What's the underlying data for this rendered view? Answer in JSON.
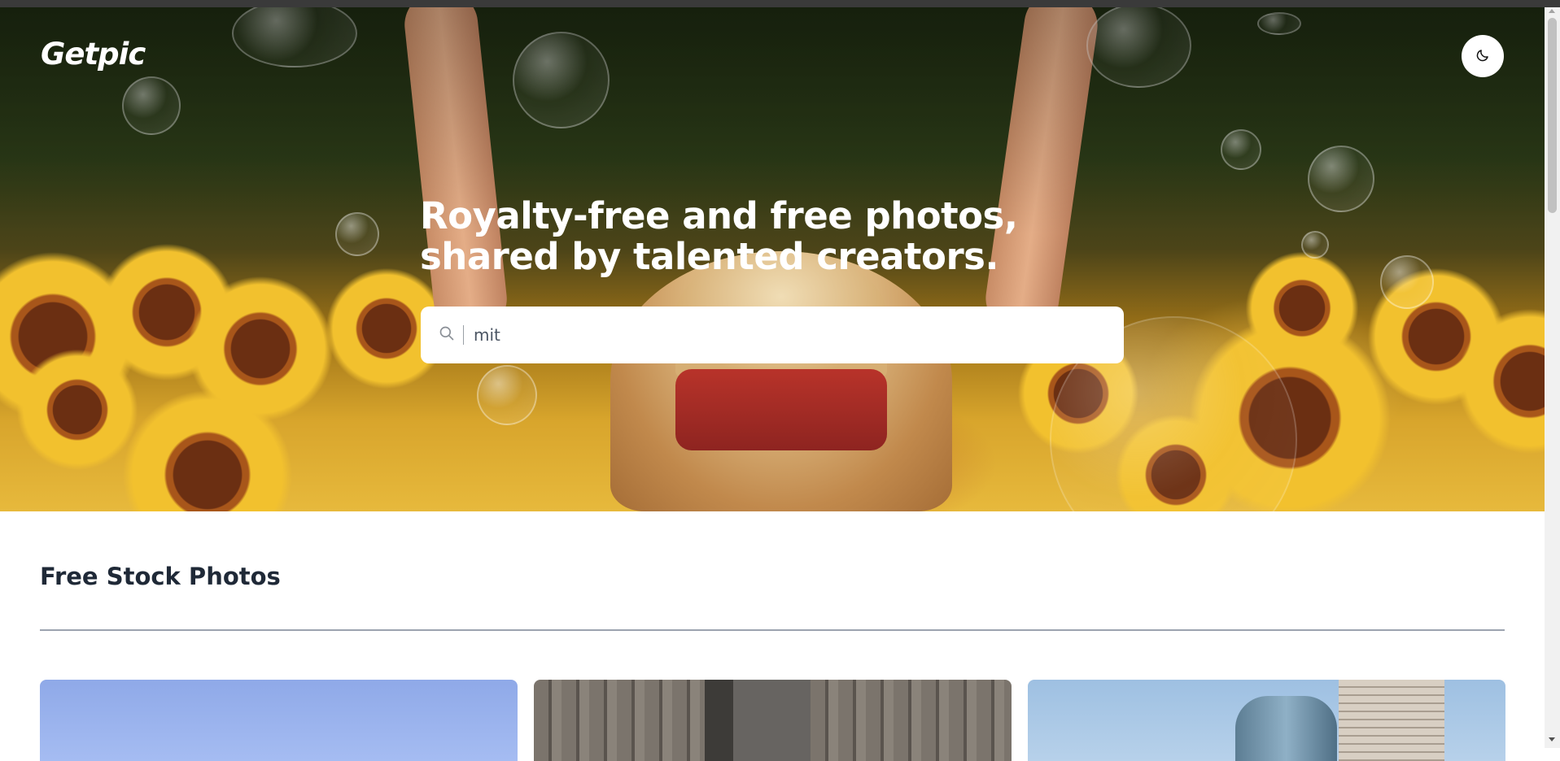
{
  "header": {
    "logo": "Getpic",
    "theme_toggle_icon": "moon-icon"
  },
  "hero": {
    "headline": "Royalty-free and free photos, shared by talented creators.",
    "background": "sunflower-field-photo",
    "search": {
      "icon": "search-icon",
      "value": "mit"
    }
  },
  "main": {
    "section_title": "Free Stock Photos",
    "photos": [
      {
        "subject": "blue-sky-photo"
      },
      {
        "subject": "stone-columns-photo"
      },
      {
        "subject": "city-skyscrapers-photo"
      }
    ]
  },
  "colors": {
    "heading": "#1f2937",
    "divider": "#9ca3af",
    "surface": "#ffffff"
  }
}
